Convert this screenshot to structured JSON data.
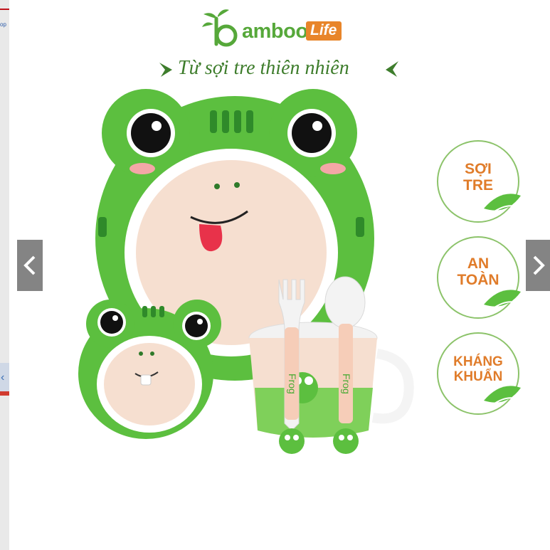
{
  "left_panel": {
    "snippet": "op"
  },
  "brand": {
    "name": "amboo",
    "suffix": "Life",
    "icon": "bamboo-b-logo",
    "colors": {
      "green": "#56a83a",
      "orange": "#e8852a"
    }
  },
  "slogan": {
    "text": "Từ sợi tre thiên nhiên"
  },
  "badges": [
    {
      "lines": [
        "SỢI",
        "TRE"
      ]
    },
    {
      "lines": [
        "AN",
        "TOÀN"
      ]
    },
    {
      "lines": [
        "KHÁNG",
        "KHUẨN"
      ]
    }
  ],
  "product": {
    "utensil_text": "Frog"
  },
  "carousel": {
    "prev_icon": "chevron-left-icon",
    "next_icon": "chevron-right-icon"
  },
  "colors": {
    "badge_text": "#e07c2a",
    "badge_ring": "#8cc36a",
    "frog_green": "#5cbf3f",
    "plate_inner": "#f6dfd0"
  }
}
